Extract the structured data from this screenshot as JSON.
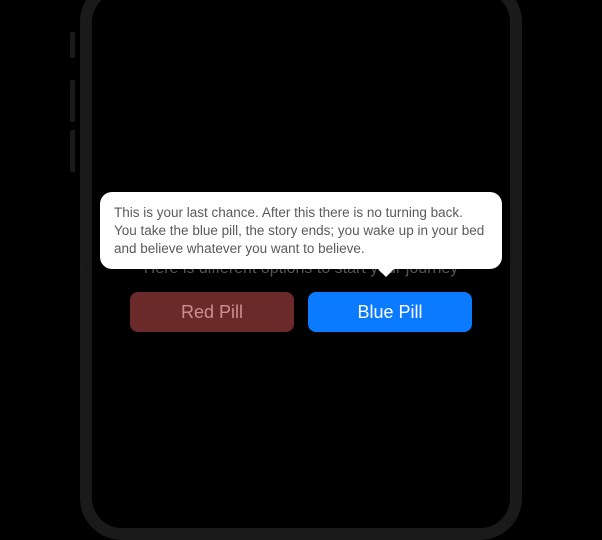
{
  "subtitle": "Here is different options to start your journey",
  "buttons": {
    "red": {
      "label": "Red Pill"
    },
    "blue": {
      "label": "Blue Pill"
    }
  },
  "tooltip": {
    "text": "This is your last chance. After this there is no turning back. You take the blue pill, the story ends; you wake up in your bed and believe whatever you want to believe."
  },
  "colors": {
    "red_bg": "#6b2a2a",
    "blue_bg": "#0a7aff",
    "tooltip_bg": "#ffffff"
  }
}
